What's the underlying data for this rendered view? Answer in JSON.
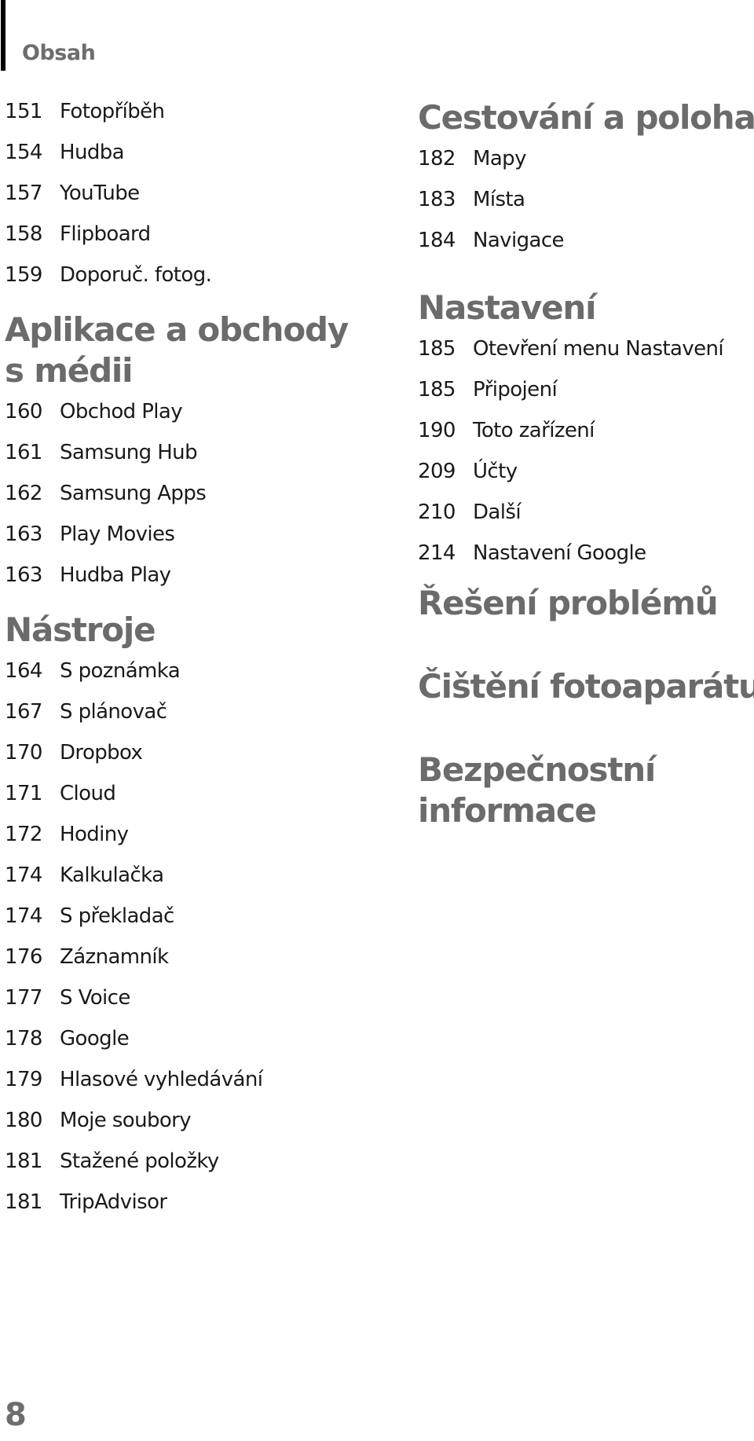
{
  "header": {
    "title": "Obsah"
  },
  "left_column": {
    "intro_entries": [
      {
        "page": "151",
        "label": "Fotopříběh"
      },
      {
        "page": "154",
        "label": "Hudba"
      },
      {
        "page": "157",
        "label": "YouTube"
      },
      {
        "page": "158",
        "label": "Flipboard"
      },
      {
        "page": "159",
        "label": "Doporuč. fotog."
      }
    ],
    "sections": [
      {
        "title_lines": [
          "Aplikace a obchody",
          "s médii"
        ],
        "entries": [
          {
            "page": "160",
            "label": "Obchod Play"
          },
          {
            "page": "161",
            "label": "Samsung Hub"
          },
          {
            "page": "162",
            "label": "Samsung Apps"
          },
          {
            "page": "163",
            "label": "Play Movies"
          },
          {
            "page": "163",
            "label": "Hudba Play"
          }
        ]
      },
      {
        "title_lines": [
          "Nástroje"
        ],
        "entries": [
          {
            "page": "164",
            "label": "S poznámka"
          },
          {
            "page": "167",
            "label": "S plánovač"
          },
          {
            "page": "170",
            "label": "Dropbox"
          },
          {
            "page": "171",
            "label": "Cloud"
          },
          {
            "page": "172",
            "label": "Hodiny"
          },
          {
            "page": "174",
            "label": "Kalkulačka"
          },
          {
            "page": "174",
            "label": "S překladač"
          },
          {
            "page": "176",
            "label": "Záznamník"
          },
          {
            "page": "177",
            "label": "S Voice"
          },
          {
            "page": "178",
            "label": "Google"
          },
          {
            "page": "179",
            "label": "Hlasové vyhledávání"
          },
          {
            "page": "180",
            "label": "Moje soubory"
          },
          {
            "page": "181",
            "label": "Stažené položky"
          },
          {
            "page": "181",
            "label": "TripAdvisor"
          }
        ]
      }
    ]
  },
  "right_column": {
    "sections": [
      {
        "title_lines": [
          "Cestování a poloha"
        ],
        "entries": [
          {
            "page": "182",
            "label": "Mapy"
          },
          {
            "page": "183",
            "label": "Místa"
          },
          {
            "page": "184",
            "label": "Navigace"
          }
        ]
      },
      {
        "title_lines": [
          "Nastavení"
        ],
        "entries": [
          {
            "page": "185",
            "label": "Otevření menu Nastavení"
          },
          {
            "page": "185",
            "label": "Připojení"
          },
          {
            "page": "190",
            "label": "Toto zařízení"
          },
          {
            "page": "209",
            "label": "Účty"
          },
          {
            "page": "210",
            "label": "Další"
          },
          {
            "page": "214",
            "label": "Nastavení Google"
          }
        ]
      },
      {
        "title_lines": [
          "Řešení problémů"
        ],
        "entries": []
      },
      {
        "title_lines": [
          "Čištění fotoaparátu"
        ],
        "entries": []
      },
      {
        "title_lines": [
          "Bezpečnostní",
          "informace"
        ],
        "entries": []
      }
    ]
  },
  "footer": {
    "page_number": "8"
  },
  "colors": {
    "heading": "#6b6b6b",
    "text": "#1a1a1a",
    "bar": "#000000"
  }
}
